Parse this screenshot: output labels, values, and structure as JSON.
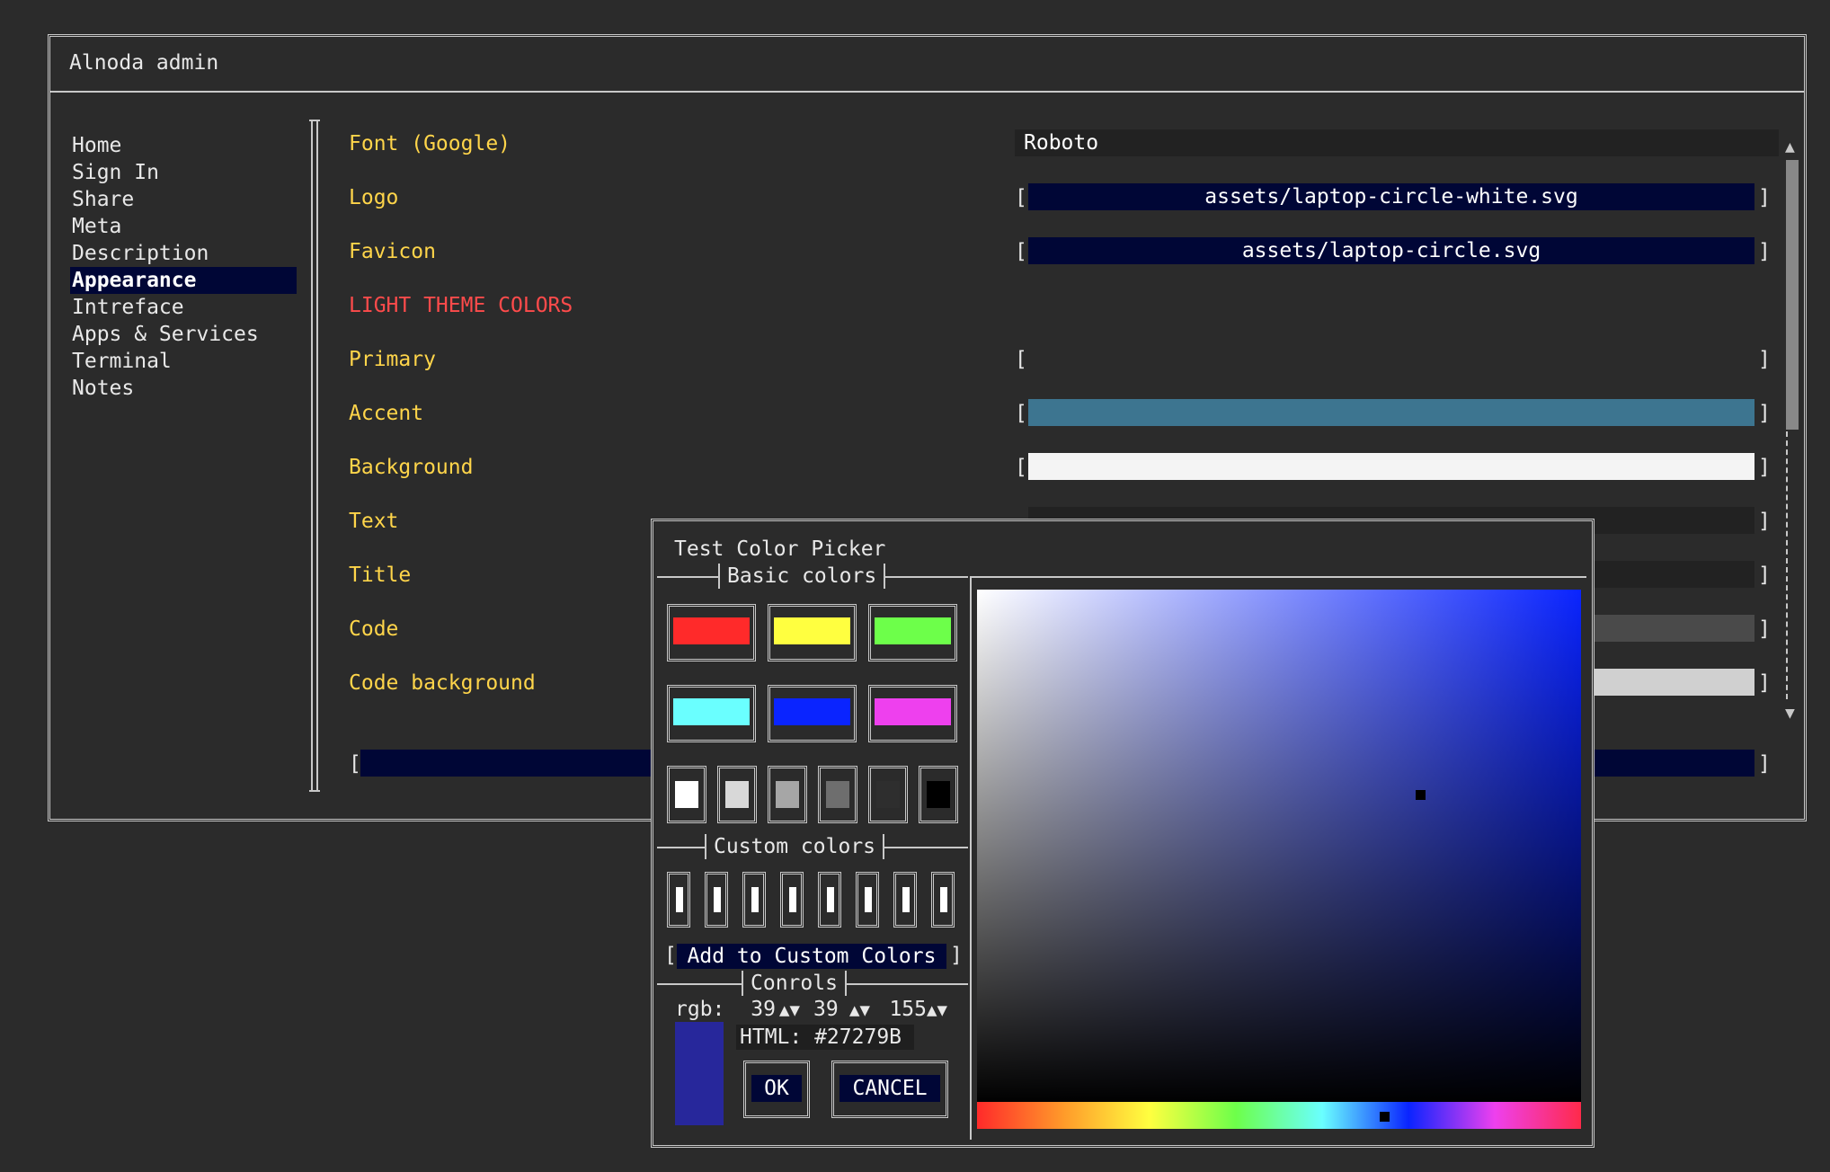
{
  "window": {
    "title": "Alnoda admin"
  },
  "sidebar": {
    "items": [
      {
        "label": "Home",
        "active": false
      },
      {
        "label": "Sign In",
        "active": false
      },
      {
        "label": "Share",
        "active": false
      },
      {
        "label": "Meta",
        "active": false
      },
      {
        "label": "Description",
        "active": false
      },
      {
        "label": "Appearance",
        "active": true
      },
      {
        "label": "Intreface",
        "active": false
      },
      {
        "label": "Apps & Services",
        "active": false
      },
      {
        "label": "Terminal",
        "active": false
      },
      {
        "label": "Notes",
        "active": false
      }
    ]
  },
  "form": {
    "font_label": "Font (Google)",
    "font_value": "Roboto",
    "logo_label": "Logo",
    "logo_value": "assets/laptop-circle-white.svg",
    "favicon_label": "Favicon",
    "favicon_value": "assets/laptop-circle.svg",
    "section_light": "LIGHT THEME COLORS",
    "primary_label": "Primary",
    "accent_label": "Accent",
    "background_label": "Background",
    "text_label": "Text",
    "title_label": "Title",
    "code_label": "Code",
    "code_bg_label": "Code background",
    "bracket_open": "[",
    "bracket_close": "]"
  },
  "field_colors": {
    "primary": "#2b2b2b",
    "accent": "#3d7590",
    "background": "#f4f4f4",
    "text": "#222222",
    "title": "#222222",
    "code": "#4a4a4a",
    "code_background": "#d0d0d0",
    "button_bg": "#000636"
  },
  "scroll": {
    "up_icon": "▲",
    "down_icon": "▼"
  },
  "dialog": {
    "title": "Test Color Picker",
    "basic_colors_label": "Basic colors",
    "basic_colors": [
      "#ff2a2a",
      "#ffff40",
      "#6dff4a",
      "#6affff",
      "#0a24ff",
      "#ee40ee"
    ],
    "gray_colors": [
      "#ffffff",
      "#d8d8d8",
      "#a6a6a6",
      "#6e6e6e",
      "#2e2e2e",
      "#000000"
    ],
    "custom_colors_label": "Custom colors",
    "custom_count": 8,
    "add_custom_label": "Add to Custom Colors",
    "controls_label": "Conrols",
    "rgb_label": "rgb:",
    "r": "39",
    "g": "39",
    "b": "155",
    "spin_icon": "▲▼",
    "html_label": "HTML: #27279B",
    "preview_color": "#27279b",
    "ok_label": "OK",
    "cancel_label": "CANCEL"
  }
}
